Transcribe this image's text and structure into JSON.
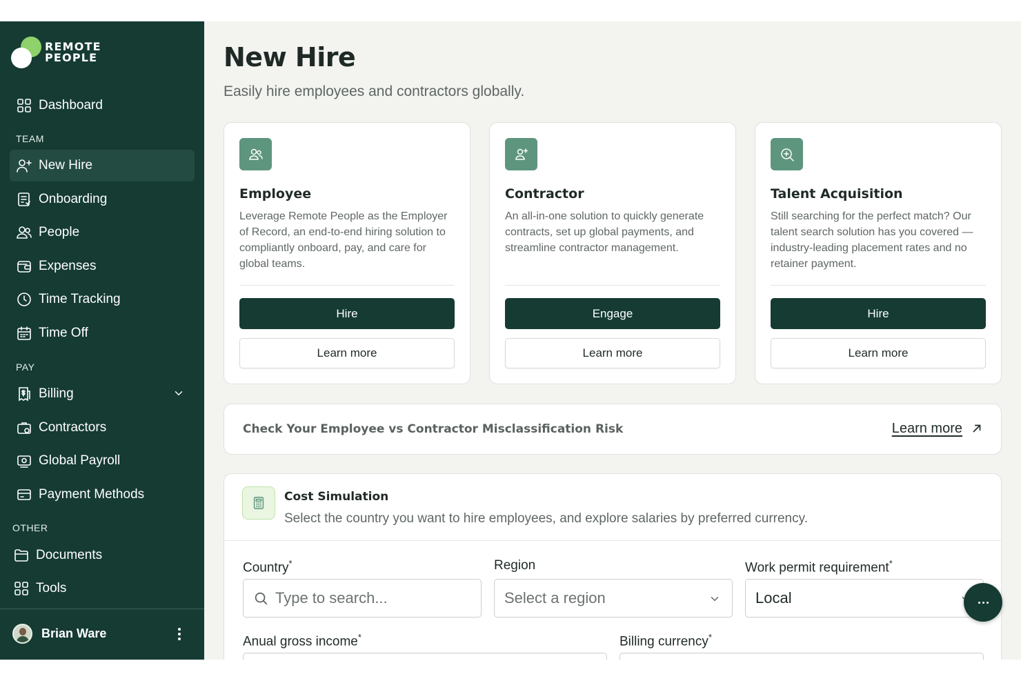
{
  "brand": {
    "line1": "REMOTE",
    "line2": "PEOPLE"
  },
  "sidebar": {
    "dashboard": {
      "label": "Dashboard",
      "icon": "grid-icon"
    },
    "sections": {
      "team": "TEAM",
      "pay": "PAY",
      "other": "OTHER"
    },
    "team_items": [
      {
        "label": "New Hire",
        "icon": "user-plus-icon",
        "active": true
      },
      {
        "label": "Onboarding",
        "icon": "checklist-icon"
      },
      {
        "label": "People",
        "icon": "users-icon"
      },
      {
        "label": "Expenses",
        "icon": "wallet-icon"
      },
      {
        "label": "Time Tracking",
        "icon": "clock-icon"
      },
      {
        "label": "Time Off",
        "icon": "calendar-icon"
      }
    ],
    "pay_items": [
      {
        "label": "Billing",
        "icon": "invoice-icon",
        "expandable": true
      },
      {
        "label": "Contractors",
        "icon": "briefcase-icon"
      },
      {
        "label": "Global Payroll",
        "icon": "payroll-icon"
      },
      {
        "label": "Payment Methods",
        "icon": "card-icon"
      }
    ],
    "other_items": [
      {
        "label": "Documents",
        "icon": "folder-icon"
      },
      {
        "label": "Tools",
        "icon": "grid-icon"
      }
    ],
    "user": {
      "name": "Brian Ware"
    }
  },
  "header": {
    "title": "New Hire",
    "subtitle": "Easily hire employees and contractors globally."
  },
  "cards": [
    {
      "title": "Employee",
      "icon": "users-icon",
      "description": "Leverage Remote People as the Employer of Record, an end-to-end hiring solution to compliantly onboard, pay, and care for global teams.",
      "primary": "Hire",
      "secondary": "Learn more"
    },
    {
      "title": "Contractor",
      "icon": "user-plus-icon",
      "description": "An all-in-one solution to quickly generate contracts, set up global payments, and streamline contractor management.",
      "primary": "Engage",
      "secondary": "Learn more"
    },
    {
      "title": "Talent Acquisition",
      "icon": "zoom-in-icon",
      "description": "Still searching for the perfect match? Our talent search solution has you covered — industry-leading placement rates and no retainer payment.",
      "primary": "Hire",
      "secondary": "Learn more"
    }
  ],
  "risk": {
    "text": "Check Your Employee vs Contractor Misclassification Risk",
    "link": "Learn more"
  },
  "simulation": {
    "title": "Cost Simulation",
    "subtitle": "Select the country you want to hire employees, and explore salaries by preferred currency.",
    "fields": {
      "country": {
        "label": "Country",
        "required": "*",
        "placeholder": "Type to search..."
      },
      "region": {
        "label": "Region",
        "placeholder": "Select a region"
      },
      "work_permit": {
        "label": "Work permit requirement",
        "required": "*",
        "value": "Local"
      },
      "income": {
        "label": "Anual gross income",
        "required": "*"
      },
      "currency": {
        "label": "Billing currency",
        "required": "*"
      }
    }
  },
  "colors": {
    "sidebar_bg": "#153b33",
    "accent_green": "#8fd16a",
    "card_icon_bg": "#5e957e",
    "main_bg": "#f3f3f0"
  }
}
